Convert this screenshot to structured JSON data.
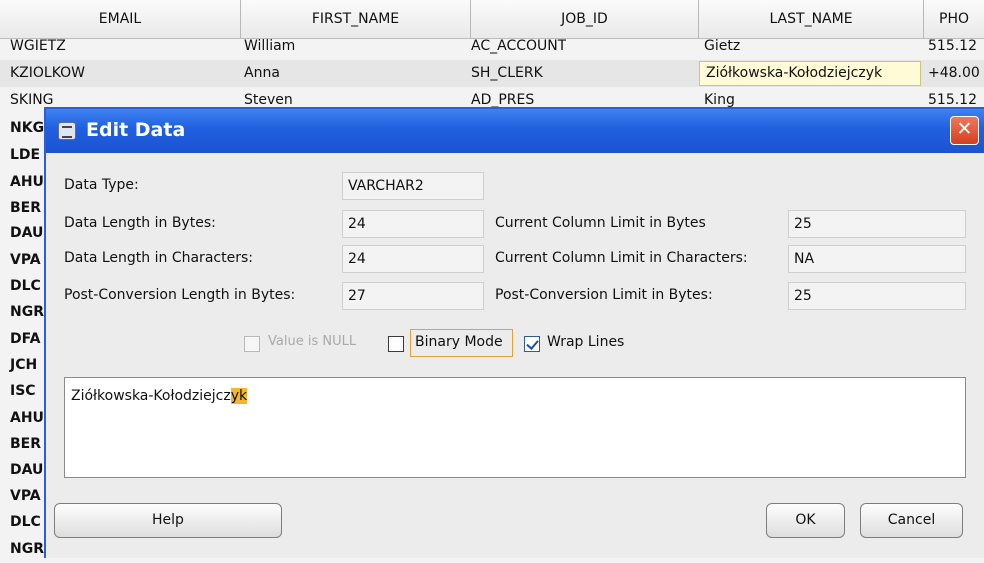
{
  "grid": {
    "columns": [
      "EMAIL",
      "FIRST_NAME",
      "JOB_ID",
      "LAST_NAME",
      "PHO"
    ],
    "rows": [
      [
        "WGIETZ",
        "William",
        "AC_ACCOUNT",
        "Gietz",
        "515.12"
      ],
      [
        "KZIOLKOW",
        "Anna",
        "SH_CLERK",
        "Ziółkowska-Kołodziejczyk",
        "+48.00"
      ],
      [
        "SKING",
        "Steven",
        "AD_PRES",
        "King",
        "515.12"
      ]
    ],
    "left_rows": [
      "NKG",
      "LDE",
      "AHU",
      "BER",
      "DAU",
      "VPA",
      "DLC",
      "NGR",
      "DFA",
      "JCH",
      "ISC",
      "AHU",
      "BER",
      "DAU",
      "VPA",
      "DLC",
      "NGR"
    ]
  },
  "dialog": {
    "title": "Edit Data",
    "close_glyph": "✕",
    "fields": {
      "data_type_label": "Data Type:",
      "data_type_value": "VARCHAR2",
      "bytes_label": "Data Length in Bytes:",
      "bytes_value": "24",
      "chars_label": "Data Length in Characters:",
      "chars_value": "24",
      "post_label": "Post-Conversion Length in Bytes:",
      "post_value": "27",
      "col_limit_bytes_label": "Current Column Limit in Bytes",
      "col_limit_bytes_value": "25",
      "col_limit_chars_label": "Current Column Limit in Characters:",
      "col_limit_chars_value": "NA",
      "post_limit_label": "Post-Conversion Limit in Bytes:",
      "post_limit_value": "25"
    },
    "options": {
      "value_is_null": {
        "label": "Value is NULL",
        "checked": false,
        "enabled": false
      },
      "binary_mode": {
        "label": "Binary Mode",
        "checked": false
      },
      "wrap_lines": {
        "label": "Wrap Lines",
        "checked": true
      }
    },
    "editor": {
      "text_normal": "Ziółkowska-Kołodziejcz",
      "text_highlighted": "yk"
    },
    "buttons": {
      "help": "Help",
      "ok": "OK",
      "cancel": "Cancel"
    },
    "colors": {
      "title_bar": "#1f5fe0",
      "highlight": "#f7b52b",
      "close": "#d3401f"
    }
  }
}
